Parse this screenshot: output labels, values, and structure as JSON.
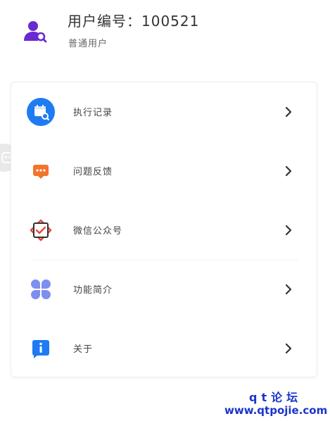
{
  "profile": {
    "user_id_label": "用户编号：100521",
    "role": "普通用户",
    "avatar_icon": "user-search-icon",
    "accent_color": "#6a2ad1"
  },
  "menu": {
    "items": [
      {
        "label": "执行记录",
        "icon": "calendar-search-icon",
        "color": "#1e7bf2"
      },
      {
        "label": "问题反馈",
        "icon": "message-dots-icon",
        "color": "#f3742a"
      },
      {
        "label": "微信公众号",
        "icon": "wechat-check-icon",
        "color": "#e2483c"
      },
      {
        "label": "功能简介",
        "icon": "grid-clover-icon",
        "color": "#7d8ff0"
      },
      {
        "label": "关于",
        "icon": "info-bubble-icon",
        "color": "#1e7bf2"
      }
    ],
    "chevron_icon": "chevron-right-icon"
  },
  "side_tab": {
    "icon": "face-icon"
  },
  "watermark": {
    "line1": "qt论坛",
    "line2": "www.qtpojie.com",
    "color": "#1a35c9"
  }
}
